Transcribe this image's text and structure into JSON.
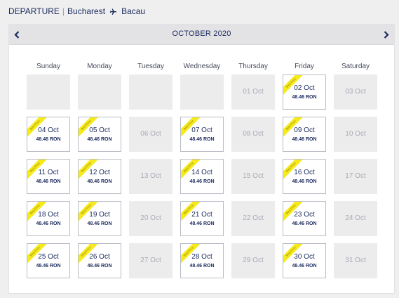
{
  "route": {
    "direction": "DEPARTURE",
    "separator": "|",
    "origin": "Bucharest",
    "destination": "Bacau"
  },
  "calendar": {
    "month_label": "OCTOBER 2020",
    "weekdays": [
      "Sunday",
      "Monday",
      "Tuesday",
      "Wednesday",
      "Thursday",
      "Friday",
      "Saturday"
    ],
    "ribbon_label": "Best Price",
    "weeks": [
      [
        {
          "state": "empty"
        },
        {
          "state": "empty"
        },
        {
          "state": "empty"
        },
        {
          "state": "empty"
        },
        {
          "state": "unavailable",
          "date": "01 Oct"
        },
        {
          "state": "available",
          "date": "02 Oct",
          "price": "48.46 RON",
          "best": true
        },
        {
          "state": "unavailable",
          "date": "03 Oct"
        }
      ],
      [
        {
          "state": "available",
          "date": "04 Oct",
          "price": "48.46 RON",
          "best": true
        },
        {
          "state": "available",
          "date": "05 Oct",
          "price": "48.46 RON",
          "best": true
        },
        {
          "state": "unavailable",
          "date": "06 Oct"
        },
        {
          "state": "available",
          "date": "07 Oct",
          "price": "48.46 RON",
          "best": true
        },
        {
          "state": "unavailable",
          "date": "08 Oct"
        },
        {
          "state": "available",
          "date": "09 Oct",
          "price": "48.46 RON",
          "best": true
        },
        {
          "state": "unavailable",
          "date": "10 Oct"
        }
      ],
      [
        {
          "state": "available",
          "date": "11 Oct",
          "price": "48.46 RON",
          "best": true
        },
        {
          "state": "available",
          "date": "12 Oct",
          "price": "48.46 RON",
          "best": true
        },
        {
          "state": "unavailable",
          "date": "13 Oct"
        },
        {
          "state": "available",
          "date": "14 Oct",
          "price": "48.46 RON",
          "best": true
        },
        {
          "state": "unavailable",
          "date": "15 Oct"
        },
        {
          "state": "available",
          "date": "16 Oct",
          "price": "48.46 RON",
          "best": true
        },
        {
          "state": "unavailable",
          "date": "17 Oct"
        }
      ],
      [
        {
          "state": "available",
          "date": "18 Oct",
          "price": "48.46 RON",
          "best": true
        },
        {
          "state": "available",
          "date": "19 Oct",
          "price": "48.46 RON",
          "best": true
        },
        {
          "state": "unavailable",
          "date": "20 Oct"
        },
        {
          "state": "available",
          "date": "21 Oct",
          "price": "48.46 RON",
          "best": true
        },
        {
          "state": "unavailable",
          "date": "22 Oct"
        },
        {
          "state": "available",
          "date": "23 Oct",
          "price": "48.46 RON",
          "best": true
        },
        {
          "state": "unavailable",
          "date": "24 Oct"
        }
      ],
      [
        {
          "state": "available",
          "date": "25 Oct",
          "price": "48.46 RON",
          "best": true
        },
        {
          "state": "available",
          "date": "26 Oct",
          "price": "48.46 RON",
          "best": true
        },
        {
          "state": "unavailable",
          "date": "27 Oct"
        },
        {
          "state": "available",
          "date": "28 Oct",
          "price": "48.46 RON",
          "best": true
        },
        {
          "state": "unavailable",
          "date": "29 Oct"
        },
        {
          "state": "available",
          "date": "30 Oct",
          "price": "48.46 RON",
          "best": true
        },
        {
          "state": "unavailable",
          "date": "31 Oct"
        }
      ]
    ]
  },
  "icons": {
    "plane": "airplane-icon",
    "prev": "chevron-left-icon",
    "next": "chevron-right-icon"
  },
  "colors": {
    "text": "#1b2a5e",
    "ribbon": "#f6ea1c",
    "unavailable_bg": "#ececed",
    "header_bg": "#e3e3e5"
  }
}
